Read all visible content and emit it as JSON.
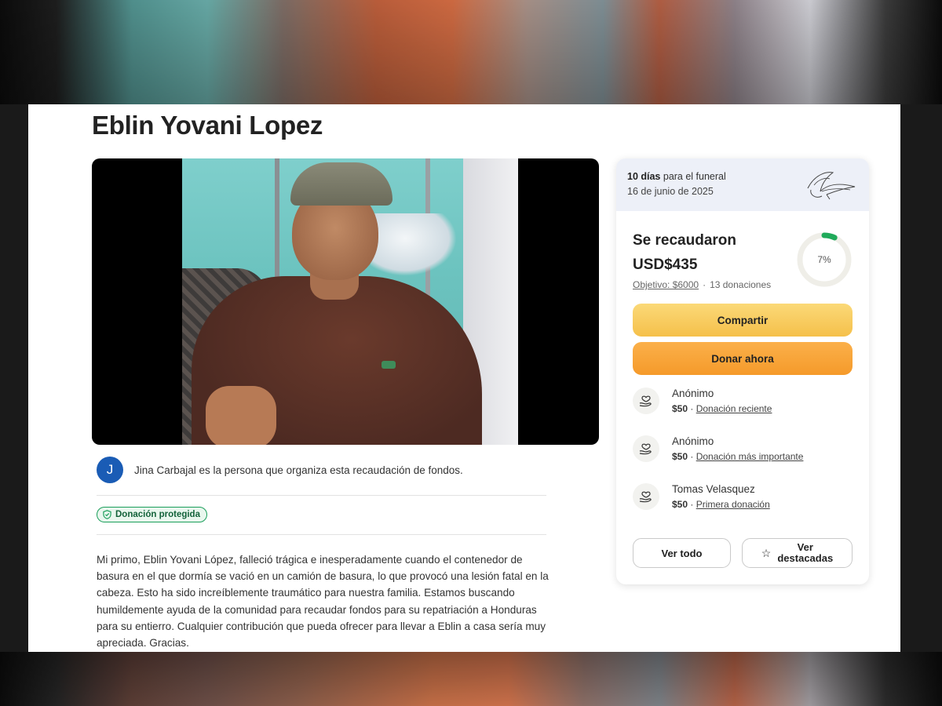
{
  "campaign": {
    "title": "Eblin Yovani Lopez"
  },
  "organizer": {
    "avatar_initial": "J",
    "text": "Jina Carbajal es la persona que organiza esta recaudación de fondos."
  },
  "badge": {
    "label": "Donación protegida"
  },
  "description": "Mi primo, Eblin Yovani López, falleció trágica e inesperadamente cuando el contenedor de basura en el que dormía se vació en un camión de basura, lo que provocó una lesión fatal en la cabeza. Esto ha sido increíblemente traumático para nuestra familia. Estamos buscando humildemente ayuda de la comunidad para recaudar fondos para su repatriación a Honduras para su entierro. Cualquier contribución que pueda ofrecer para llevar a Eblin a casa sería muy apreciada. Gracias.",
  "card": {
    "days_bold": "10 días",
    "days_rest": " para el funeral",
    "date": "16 de junio de 2025",
    "raised_label": "Se recaudaron",
    "raised_amount": "USD$435",
    "goal": "Objetivo: $6000",
    "donations": "13 donaciones",
    "percent_label": "7%",
    "progress": 0.07,
    "share_label": "Compartir",
    "donate_label": "Donar ahora",
    "see_all_label": "Ver todo",
    "featured_label_1": "Ver",
    "featured_label_2": "destacadas"
  },
  "donors": [
    {
      "name": "Anónimo",
      "amount": "$50",
      "tag": "Donación reciente"
    },
    {
      "name": "Anónimo",
      "amount": "$50",
      "tag": "Donación más importante"
    },
    {
      "name": "Tomas Velasquez",
      "amount": "$50",
      "tag": "Primera donación"
    }
  ],
  "colors": {
    "accent_green": "#1a9e5a",
    "share_button": "#f5c04a",
    "donate_button": "#f59a2a",
    "avatar": "#1a5cb5"
  },
  "icons": {
    "badge": "shield-icon",
    "header": "lily-flower-icon",
    "donor": "heart-hand-icon",
    "featured": "star-icon"
  }
}
